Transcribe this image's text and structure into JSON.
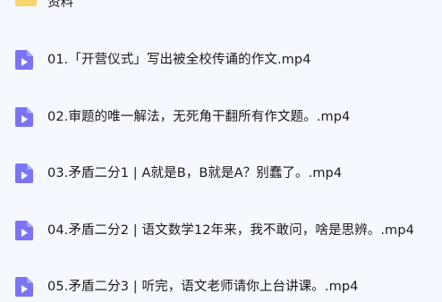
{
  "folder": {
    "name": "资料",
    "icon": "folder-icon",
    "color": "#f7c84a"
  },
  "files": [
    {
      "name": "01.「开营仪式」写出被全校传诵的作文.mp4",
      "icon": "video-file-icon"
    },
    {
      "name": "02.审题的唯一解法，无死角干翻所有作文题。.mp4",
      "icon": "video-file-icon"
    },
    {
      "name": "03.矛盾二分1 | A就是B，B就是A？别蠢了。.mp4",
      "icon": "video-file-icon"
    },
    {
      "name": "04.矛盾二分2 | 语文数学12年来，我不敢问，啥是思辨。.mp4",
      "icon": "video-file-icon"
    },
    {
      "name": "05.矛盾二分3 | 听完，语文老师请你上台讲课。.mp4",
      "icon": "video-file-icon"
    }
  ],
  "colors": {
    "background": "#f5f8ff",
    "video_icon": "#7b74f5",
    "video_icon_light": "#a7a2fb",
    "text": "#1a1a1a"
  }
}
